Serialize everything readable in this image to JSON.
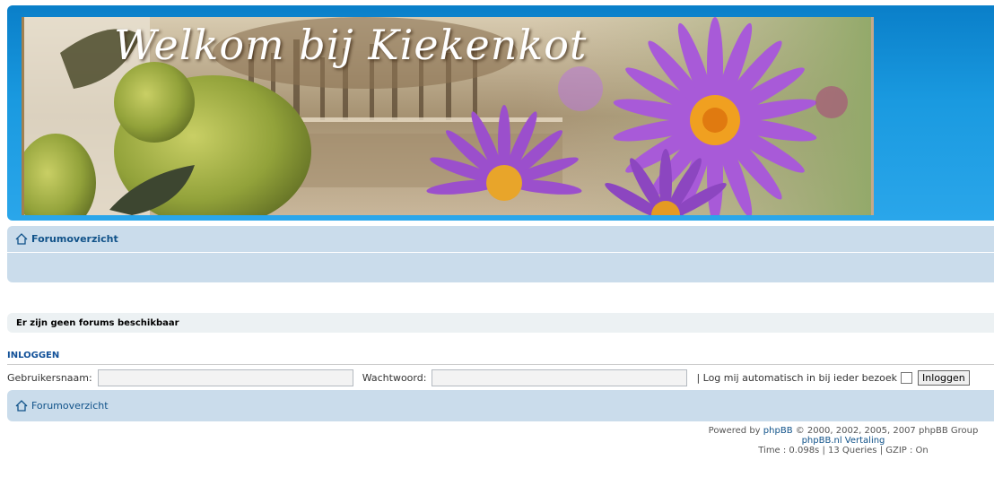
{
  "header": {
    "banner_title": "Welkom bij Kiekenkot"
  },
  "nav": {
    "home_label": "Forumoverzicht",
    "home_icon": "home-icon"
  },
  "notice": "Er zijn geen forums beschikbaar",
  "login": {
    "title": "INLOGGEN",
    "username_label": "Gebruikersnaam:",
    "username_value": "",
    "password_label": "Wachtwoord:",
    "password_value": "",
    "auto_login_label": "| Log mij automatisch in bij ieder bezoek",
    "auto_login_checked": false,
    "submit_label": "Inloggen"
  },
  "footer": {
    "powered_prefix": "Powered by",
    "powered_link": "phpBB",
    "powered_suffix": "© 2000, 2002, 2005, 2007 phpBB Group",
    "translation_link": "phpBB.nl Vertaling",
    "stats": "Time : 0.098s | 13 Queries | GZIP : On"
  },
  "colors": {
    "header_blue": "#1a9ae0",
    "nav_bg": "#cadceb",
    "link": "#105289"
  }
}
